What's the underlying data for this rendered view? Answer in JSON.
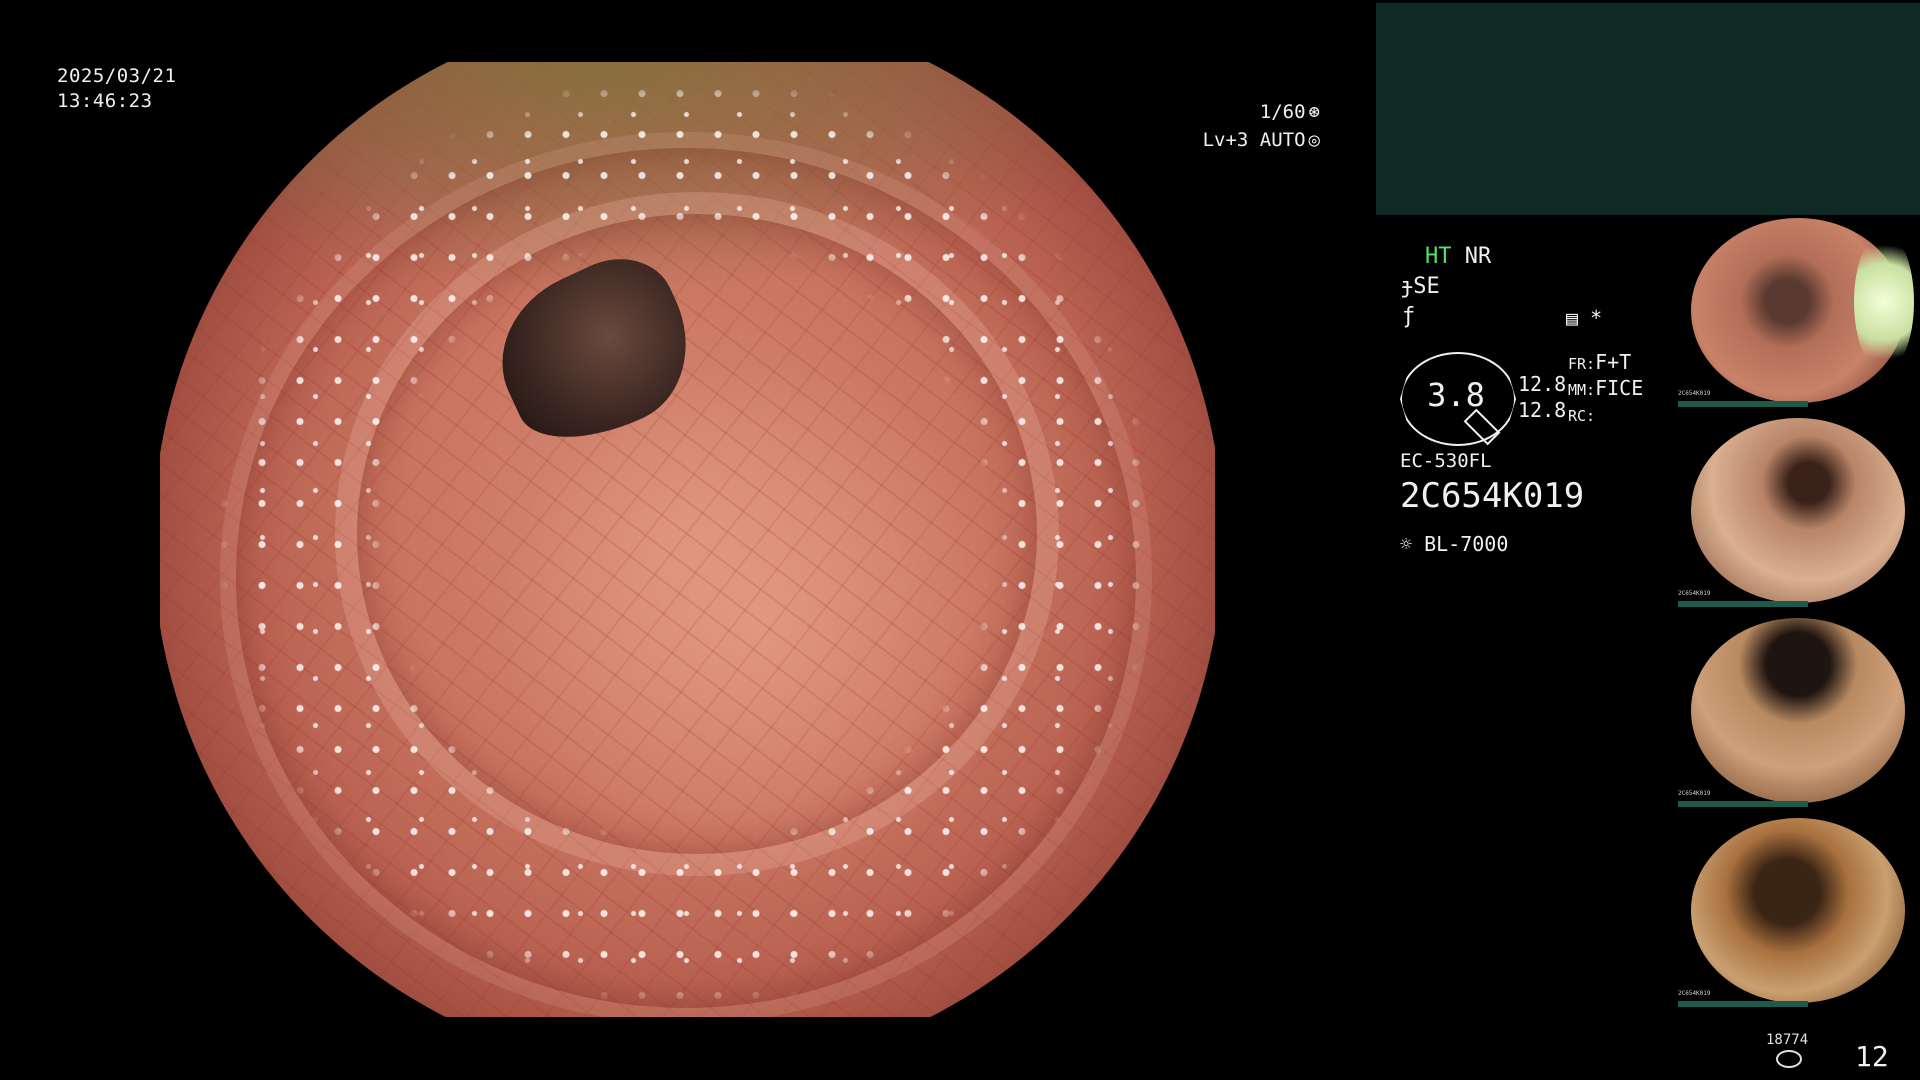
{
  "overlay": {
    "date": "2025/03/21",
    "time": "13:46:23",
    "shutter": "1/60",
    "shutter_icon": "shutter-icon",
    "level": "Lv+3 AUTO",
    "auto_icon": "auto-iris-icon"
  },
  "info": {
    "ht": "HT",
    "nr": "NR",
    "se": "SE",
    "se_icon": "structure-enhance-icon",
    "f_icon": "freeze-icon",
    "memo_icon": "memo-icon",
    "asterisk": "*",
    "gauge_value": "3.8",
    "val1": "12.8",
    "val2": "12.8",
    "fr_label": "FR:",
    "fr_value": "F+T",
    "mm_label": "MM:",
    "mm_value": "FICE",
    "rc_label": "RC:",
    "scope_model": "EC-530FL",
    "scope_serial": "2C654K019",
    "light_icon": "light-source-icon",
    "light_source": "BL-7000"
  },
  "thumbnails": [
    {
      "caption": "2C654K019"
    },
    {
      "caption": "2C654K019"
    },
    {
      "caption": "2C654K019"
    },
    {
      "caption": "2C654K019"
    }
  ],
  "footer": {
    "count": "18774",
    "disk_icon": "disk-icon",
    "page": "12"
  },
  "colors": {
    "accent_green": "#55e06b",
    "panel_teal": "#0f2a25"
  }
}
